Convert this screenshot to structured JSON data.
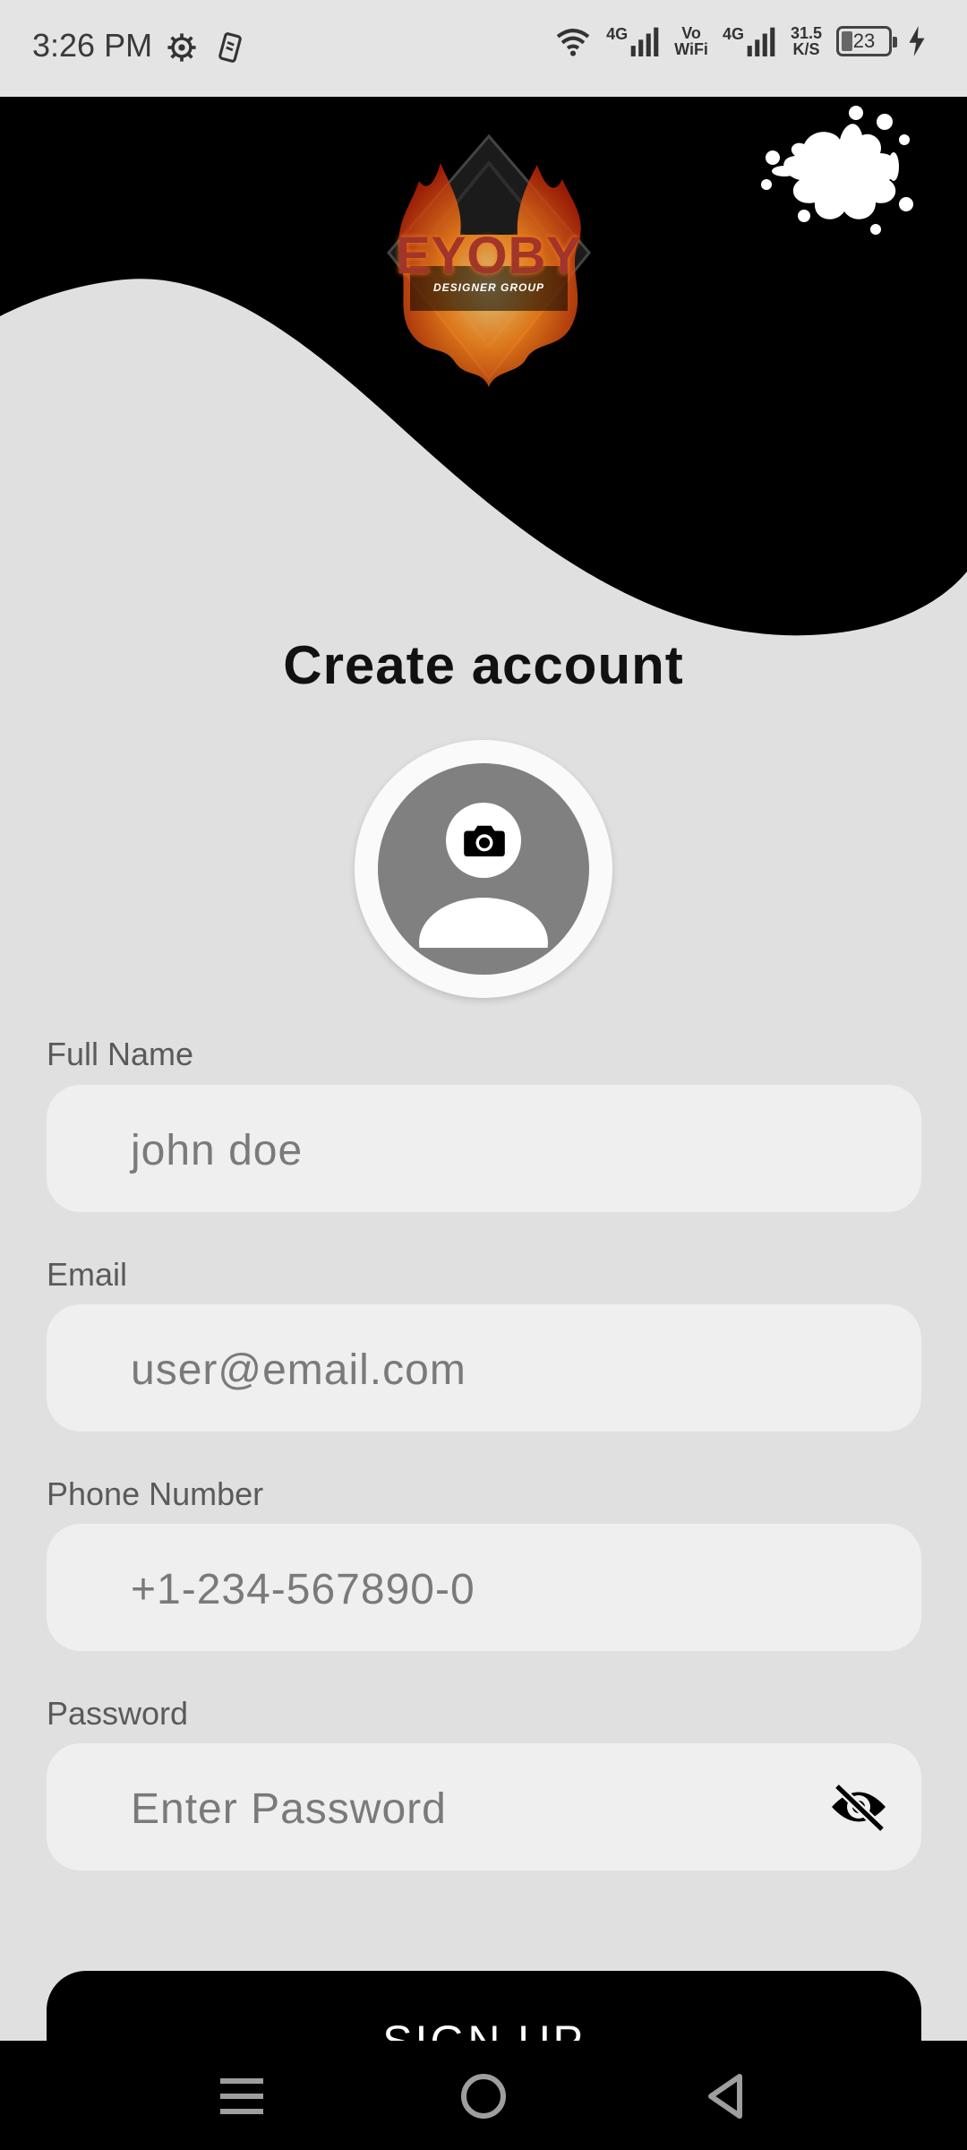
{
  "status_bar": {
    "time": "3:26 PM",
    "left_icons": [
      "settings-icon",
      "notification-icon"
    ],
    "network_1": "4G",
    "volte": "Vo",
    "wifi_call": "WiFi",
    "network_2": "4G",
    "speed_value": "31.5",
    "speed_unit": "K/S",
    "battery_level": "23"
  },
  "header": {
    "logo_title": "EYOBY",
    "logo_subtitle": "DESIGNER GROUP",
    "colors": {
      "header_bg": "#000000",
      "page_bg": "#e0e0e0"
    }
  },
  "page": {
    "title": "Create account"
  },
  "avatar": {
    "icon": "camera-icon"
  },
  "form": {
    "full_name": {
      "label": "Full Name",
      "placeholder": "john doe"
    },
    "email": {
      "label": "Email",
      "placeholder": "user@email.com"
    },
    "phone": {
      "label": "Phone Number",
      "placeholder": "+1-234-567890-0"
    },
    "password": {
      "label": "Password",
      "placeholder": "Enter Password",
      "toggle_icon": "eye-off-icon"
    }
  },
  "signup": {
    "label": "SIGN UP"
  },
  "nav": {
    "items": [
      "menu-icon",
      "home-icon",
      "back-icon"
    ]
  }
}
